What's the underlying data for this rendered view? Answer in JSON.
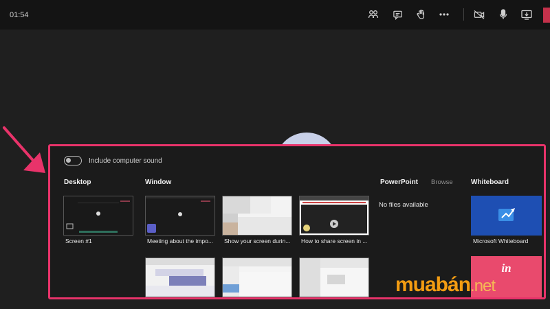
{
  "meeting": {
    "timer": "01:54"
  },
  "toolbar": {
    "icons": [
      "people-icon",
      "chat-icon",
      "raise-hand-icon",
      "more-options-icon",
      "camera-off-icon",
      "microphone-icon",
      "share-tray-icon"
    ],
    "leave_color": "#c4314b"
  },
  "share_panel": {
    "border_color": "#e8336a",
    "include_sound_label": "Include computer sound",
    "sections": {
      "desktop": "Desktop",
      "window": "Window",
      "powerpoint": "PowerPoint",
      "browse": "Browse",
      "whiteboard": "Whiteboard"
    },
    "desktop_screens": [
      {
        "label": "Screen #1"
      }
    ],
    "windows": [
      {
        "label": "Meeting about the impo..."
      },
      {
        "label": "Show your screen durin..."
      },
      {
        "label": "How to share screen in ..."
      },
      {
        "label": ""
      },
      {
        "label": ""
      },
      {
        "label": ""
      }
    ],
    "powerpoint_empty": "No files available",
    "whiteboard_apps": [
      {
        "label": "Microsoft Whiteboard"
      },
      {
        "label": "in"
      }
    ]
  },
  "watermark": {
    "main": "muabán",
    "suffix": ".net"
  }
}
